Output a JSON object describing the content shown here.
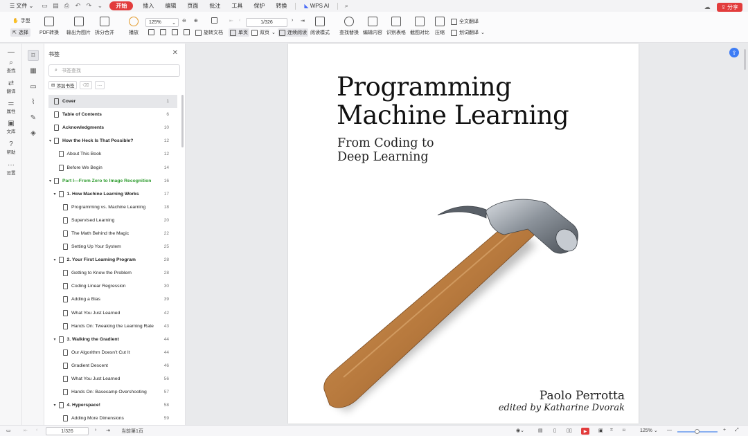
{
  "menubar": {
    "file": "文件",
    "tabs": [
      "开始",
      "插入",
      "编辑",
      "页面",
      "批注",
      "工具",
      "保护",
      "转换"
    ],
    "wps_ai": "WPS AI",
    "share": "分享"
  },
  "ribbon": {
    "hand": "手型",
    "select": "选择",
    "pdf_convert": "PDF转换",
    "export_image": "输出为图片",
    "split_merge": "拆分合并",
    "play": "播放",
    "zoom": "125%",
    "page_indicator": "1/326",
    "rotate": "旋转文档",
    "single_page": "单页",
    "double_page": "双页",
    "continuous": "连续阅读",
    "reading_mode": "阅读模式",
    "find_replace": "查找替换",
    "edit_content": "编辑内容",
    "recognize_table": "识别表格",
    "screenshot_compare": "截图对比",
    "compress": "压缩",
    "full_translate": "全文翻译",
    "word_translate": "划词翻译"
  },
  "rail": {
    "items": [
      "查找",
      "翻译",
      "属性",
      "文库",
      "帮助",
      "设置"
    ]
  },
  "panel": {
    "title": "书签",
    "search_placeholder": "书签查找",
    "add_bookmark": "添加书签",
    "bookmarks": [
      {
        "label": "Cover",
        "page": "1",
        "level": 0,
        "toggle": "",
        "style": "bold",
        "selected": true
      },
      {
        "label": "Table of Contents",
        "page": "6",
        "level": 0,
        "toggle": "",
        "style": "bold"
      },
      {
        "label": "Acknowledgments",
        "page": "10",
        "level": 0,
        "toggle": "",
        "style": "bold"
      },
      {
        "label": "How the Heck Is That Possible?",
        "page": "12",
        "level": 0,
        "toggle": "▾",
        "style": "bold"
      },
      {
        "label": "About This Book",
        "page": "12",
        "level": 1,
        "toggle": "",
        "style": ""
      },
      {
        "label": "Before We Begin",
        "page": "14",
        "level": 1,
        "toggle": "",
        "style": ""
      },
      {
        "label": "Part I—From Zero to Image Recognition",
        "page": "16",
        "level": 0,
        "toggle": "▾",
        "style": "green"
      },
      {
        "label": "1. How Machine Learning Works",
        "page": "17",
        "level": 1,
        "toggle": "▾",
        "style": "bold"
      },
      {
        "label": "Programming vs. Machine Learning",
        "page": "18",
        "level": 2,
        "toggle": "",
        "style": ""
      },
      {
        "label": "Supervised Learning",
        "page": "20",
        "level": 2,
        "toggle": "",
        "style": ""
      },
      {
        "label": "The Math Behind the Magic",
        "page": "22",
        "level": 2,
        "toggle": "",
        "style": ""
      },
      {
        "label": "Setting Up Your System",
        "page": "25",
        "level": 2,
        "toggle": "",
        "style": ""
      },
      {
        "label": "2. Your First Learning Program",
        "page": "28",
        "level": 1,
        "toggle": "▾",
        "style": "bold"
      },
      {
        "label": "Getting to Know the Problem",
        "page": "28",
        "level": 2,
        "toggle": "",
        "style": ""
      },
      {
        "label": "Coding Linear Regression",
        "page": "30",
        "level": 2,
        "toggle": "",
        "style": ""
      },
      {
        "label": "Adding a Bias",
        "page": "39",
        "level": 2,
        "toggle": "",
        "style": ""
      },
      {
        "label": "What You Just Learned",
        "page": "42",
        "level": 2,
        "toggle": "",
        "style": ""
      },
      {
        "label": "Hands On: Tweaking the Learning Rate",
        "page": "43",
        "level": 2,
        "toggle": "",
        "style": ""
      },
      {
        "label": "3. Walking the Gradient",
        "page": "44",
        "level": 1,
        "toggle": "▾",
        "style": "bold"
      },
      {
        "label": "Our Algorithm Doesn’t Cut It",
        "page": "44",
        "level": 2,
        "toggle": "",
        "style": ""
      },
      {
        "label": "Gradient Descent",
        "page": "46",
        "level": 2,
        "toggle": "",
        "style": ""
      },
      {
        "label": "What You Just Learned",
        "page": "56",
        "level": 2,
        "toggle": "",
        "style": ""
      },
      {
        "label": "Hands On: Basecamp Overshooting",
        "page": "57",
        "level": 2,
        "toggle": "",
        "style": ""
      },
      {
        "label": "4. Hyperspace!",
        "page": "58",
        "level": 1,
        "toggle": "▾",
        "style": "bold"
      },
      {
        "label": "Adding More Dimensions",
        "page": "59",
        "level": 2,
        "toggle": "",
        "style": ""
      }
    ]
  },
  "document": {
    "title_line1": "Programming",
    "title_line2": "Machine Learning",
    "subtitle_line1": "From Coding to",
    "subtitle_line2": "Deep Learning",
    "author": "Paolo Perrotta",
    "editor": "edited by Katharine Dvorak"
  },
  "status": {
    "page": "1/326",
    "page_info": "当前第1页",
    "zoom": "125%"
  }
}
